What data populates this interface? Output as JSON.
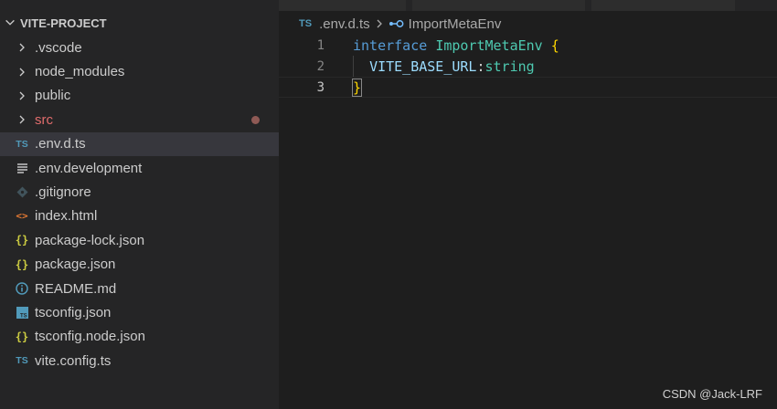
{
  "explorer": {
    "title": "VITE-PROJECT",
    "items": [
      {
        "label": ".vscode",
        "kind": "folder"
      },
      {
        "label": "node_modules",
        "kind": "folder"
      },
      {
        "label": "public",
        "kind": "folder"
      },
      {
        "label": "src",
        "kind": "folder",
        "color": "#e06c6c",
        "modified": true
      },
      {
        "label": ".env.d.ts",
        "kind": "ts",
        "selected": true
      },
      {
        "label": ".env.development",
        "kind": "lines"
      },
      {
        "label": ".gitignore",
        "kind": "git"
      },
      {
        "label": "index.html",
        "kind": "html"
      },
      {
        "label": "package-lock.json",
        "kind": "json"
      },
      {
        "label": "package.json",
        "kind": "json"
      },
      {
        "label": "README.md",
        "kind": "info"
      },
      {
        "label": "tsconfig.json",
        "kind": "tsconfig"
      },
      {
        "label": "tsconfig.node.json",
        "kind": "json"
      },
      {
        "label": "vite.config.ts",
        "kind": "ts"
      }
    ]
  },
  "breadcrumb": {
    "file_badge": "TS",
    "file": ".env.d.ts",
    "symbol": "ImportMetaEnv"
  },
  "editor": {
    "lines": [
      {
        "number": "1",
        "keyword": "interface",
        "name": "ImportMetaEnv",
        "brace": "{"
      },
      {
        "number": "2",
        "prop": "VITE_BASE_URL",
        "colon": ":",
        "type": "string"
      },
      {
        "number": "3",
        "brace": "}"
      }
    ]
  },
  "icons": {
    "ts_badge": "TS",
    "braces": "{}",
    "html": "<>"
  },
  "watermark": "CSDN @Jack-LRF"
}
